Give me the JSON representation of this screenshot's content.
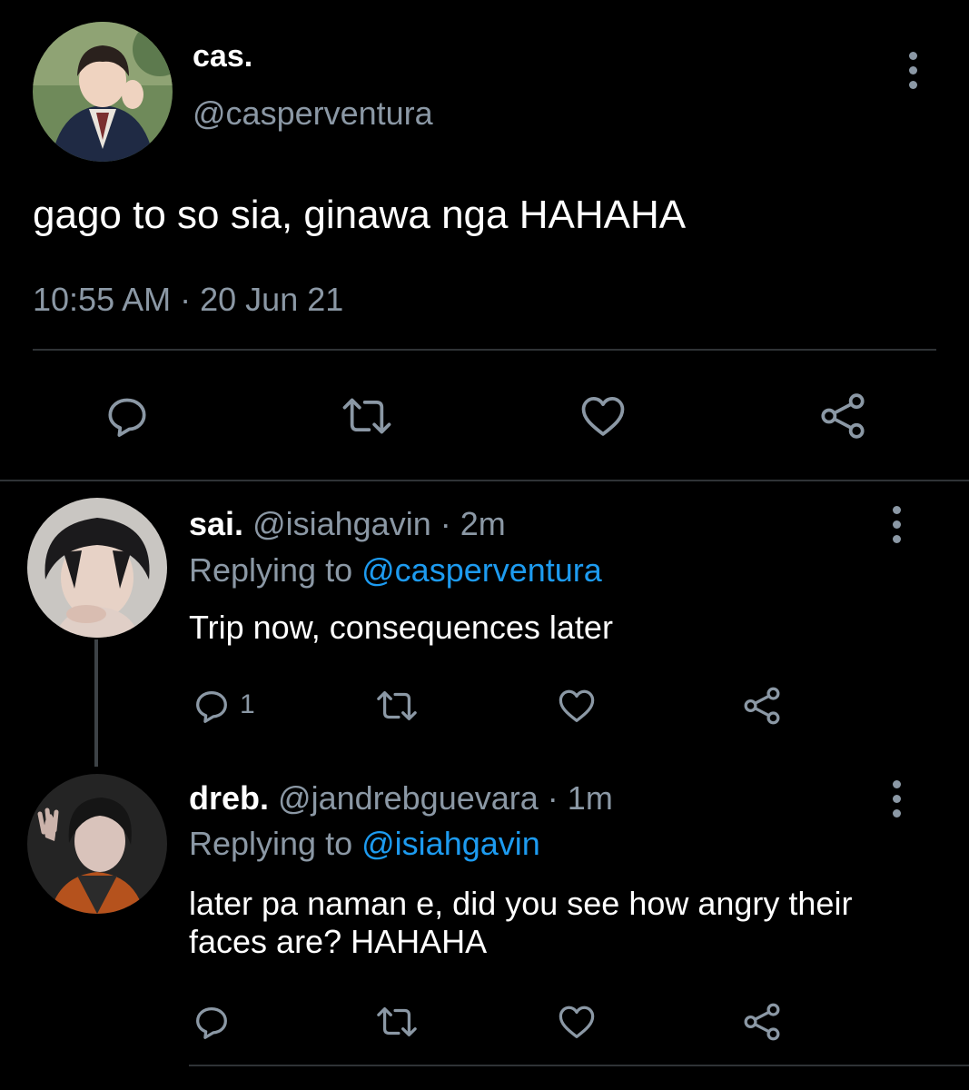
{
  "main_tweet": {
    "display_name": "cas.",
    "handle": "@casperventura",
    "text": "gago to so sia, ginawa nga HAHAHA",
    "time": "10:55 AM",
    "separator": "·",
    "date": "20 Jun 21",
    "actions": [
      "reply-icon",
      "retweet-icon",
      "like-icon",
      "share-icon"
    ]
  },
  "replies": [
    {
      "display_name": "sai.",
      "handle": "@isiahgavin",
      "dot": "·",
      "time": "2m",
      "replying_prefix": "Replying to",
      "replying_to": "@casperventura",
      "text": "Trip now, consequences later",
      "reply_count": "1"
    },
    {
      "display_name": "dreb.",
      "handle": "@jandrebguevara",
      "dot": "·",
      "time": "1m",
      "replying_prefix": "Replying to",
      "replying_to": "@isiahgavin",
      "text": "later pa naman e, did you see how angry their faces are? HAHAHA",
      "reply_count": ""
    }
  ],
  "colors": {
    "background": "#000000",
    "primary_text": "#ffffff",
    "secondary_text": "#8b98a5",
    "link": "#1d9bf0",
    "divider": "#2f3336"
  }
}
